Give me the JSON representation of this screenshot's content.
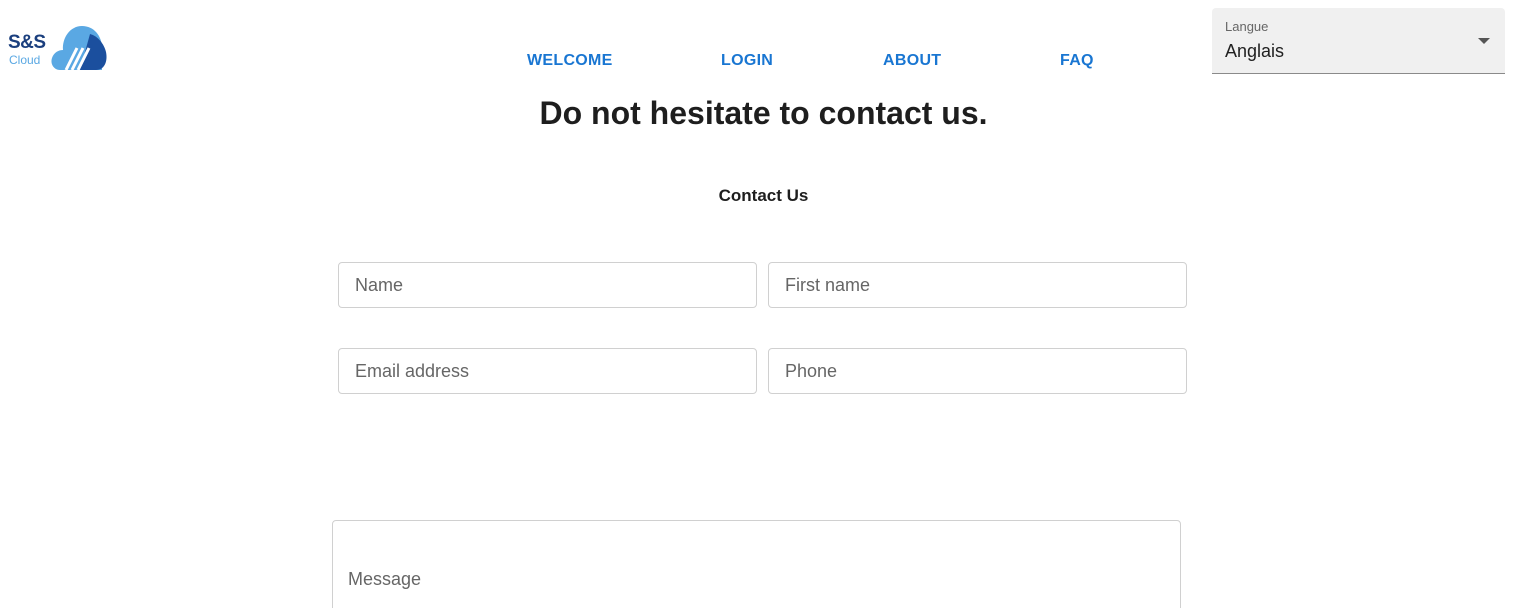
{
  "logo": {
    "title": "S&S",
    "subtitle": "Cloud"
  },
  "nav": {
    "items": [
      {
        "label": "WELCOME"
      },
      {
        "label": "LOGIN"
      },
      {
        "label": "ABOUT"
      },
      {
        "label": "FAQ"
      }
    ]
  },
  "language": {
    "label": "Langue",
    "selected": "Anglais"
  },
  "headline": "Do not hesitate to contact us.",
  "form": {
    "title": "Contact Us",
    "name_placeholder": "Name",
    "first_name_placeholder": "First name",
    "email_placeholder": "Email address",
    "phone_placeholder": "Phone",
    "message_placeholder": "Message"
  },
  "colors": {
    "accent": "#1976d2",
    "logo_dark": "#1b3f7e",
    "logo_light": "#5aa8e3"
  }
}
